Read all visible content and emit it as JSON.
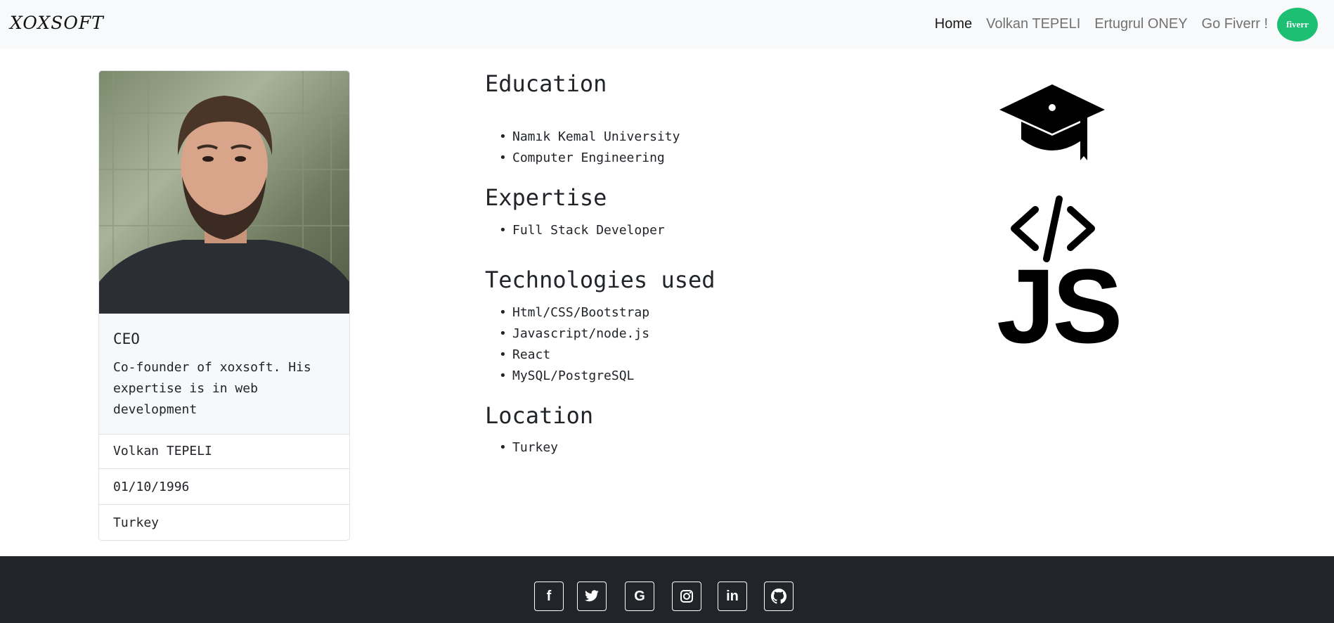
{
  "navbar": {
    "brand": "XOXSOFT",
    "links": [
      {
        "label": "Home"
      },
      {
        "label": "Volkan TEPELI"
      },
      {
        "label": "Ertugrul ONEY"
      },
      {
        "label": "Go Fiverr !"
      }
    ],
    "fiverr_badge": "fiverr",
    "fiverr_color": "#1dbf73"
  },
  "profile_card": {
    "title": "CEO",
    "text": "Co-founder of xoxsoft. His expertise is in web development",
    "items": [
      "Volkan TEPELI",
      "01/10/1996",
      "Turkey"
    ]
  },
  "sections": {
    "education": {
      "heading": "Education",
      "items": [
        "Namık Kemal University",
        "Computer Engineering"
      ]
    },
    "expertise": {
      "heading": "Expertise",
      "items": [
        "Full Stack Developer"
      ]
    },
    "technologies": {
      "heading": "Technologies used",
      "items": [
        "Html/CSS/Bootstrap",
        "Javascript/node.js",
        "React",
        "MySQL/PostgreSQL"
      ]
    },
    "location": {
      "heading": "Location",
      "items": [
        "Turkey"
      ]
    }
  },
  "icons": {
    "education": "graduation-cap-icon",
    "code": "code-icon",
    "js": "JS"
  },
  "footer": {
    "social": [
      {
        "name": "facebook",
        "glyph": "f"
      },
      {
        "name": "twitter",
        "glyph": "t"
      },
      {
        "name": "google",
        "glyph": "G"
      },
      {
        "name": "instagram",
        "glyph": "◎"
      },
      {
        "name": "linkedin",
        "glyph": "in"
      },
      {
        "name": "github",
        "glyph": "gh"
      }
    ],
    "color": "#212529"
  }
}
